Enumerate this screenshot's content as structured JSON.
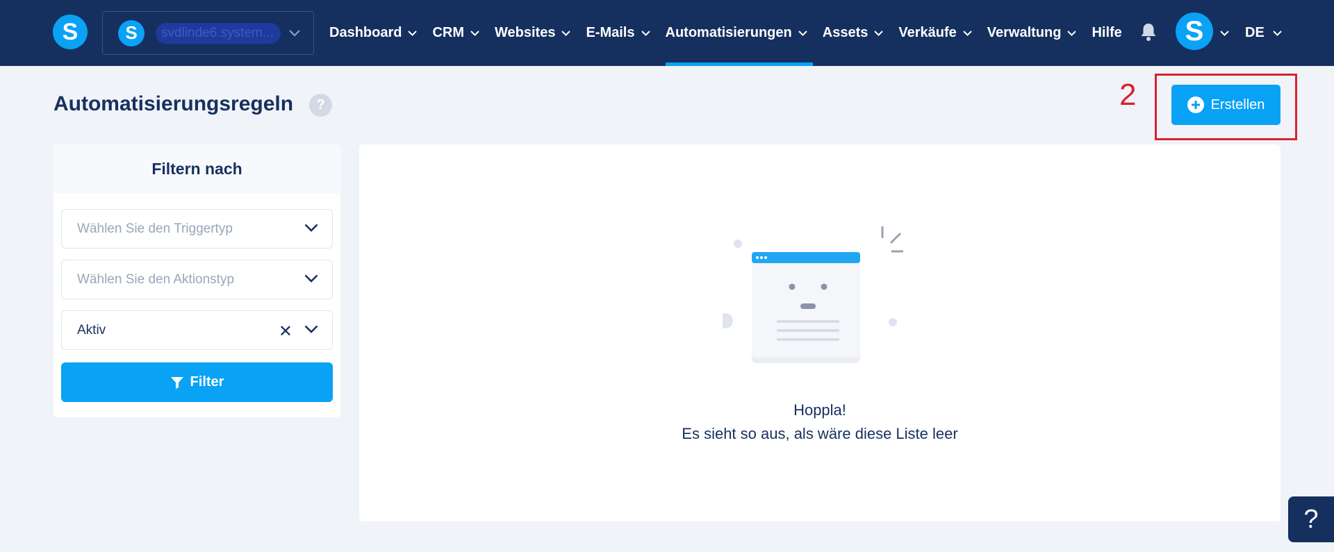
{
  "brand": {
    "logo_letter": "S",
    "accent": "#09a2f5",
    "nav_bg": "#15305f"
  },
  "account": {
    "avatar_letter": "S",
    "name": "svdlinde6.system..."
  },
  "nav": {
    "items": [
      {
        "label": "Dashboard",
        "dropdown": true
      },
      {
        "label": "CRM",
        "dropdown": true
      },
      {
        "label": "Websites",
        "dropdown": true
      },
      {
        "label": "E-Mails",
        "dropdown": true
      },
      {
        "label": "Automatisierungen",
        "dropdown": true,
        "active": true
      },
      {
        "label": "Assets",
        "dropdown": true
      },
      {
        "label": "Verkäufe",
        "dropdown": true
      },
      {
        "label": "Verwaltung",
        "dropdown": true
      },
      {
        "label": "Hilfe",
        "dropdown": false
      }
    ],
    "user_avatar_letter": "S",
    "language": "DE"
  },
  "page": {
    "title": "Automatisierungsregeln",
    "help_glyph": "?",
    "create_label": "Erstellen",
    "annotation_number": "2",
    "annotation_color": "#d8212f"
  },
  "filter": {
    "heading": "Filtern nach",
    "trigger_placeholder": "Wählen Sie den Triggertyp",
    "action_placeholder": "Wählen Sie den Aktionstyp",
    "status_value": "Aktiv",
    "button_label": "Filter"
  },
  "list": {
    "empty_title": "Hoppla!",
    "empty_message": "Es sieht so aus, als wäre diese Liste leer"
  },
  "help_widget": {
    "glyph": "?"
  }
}
